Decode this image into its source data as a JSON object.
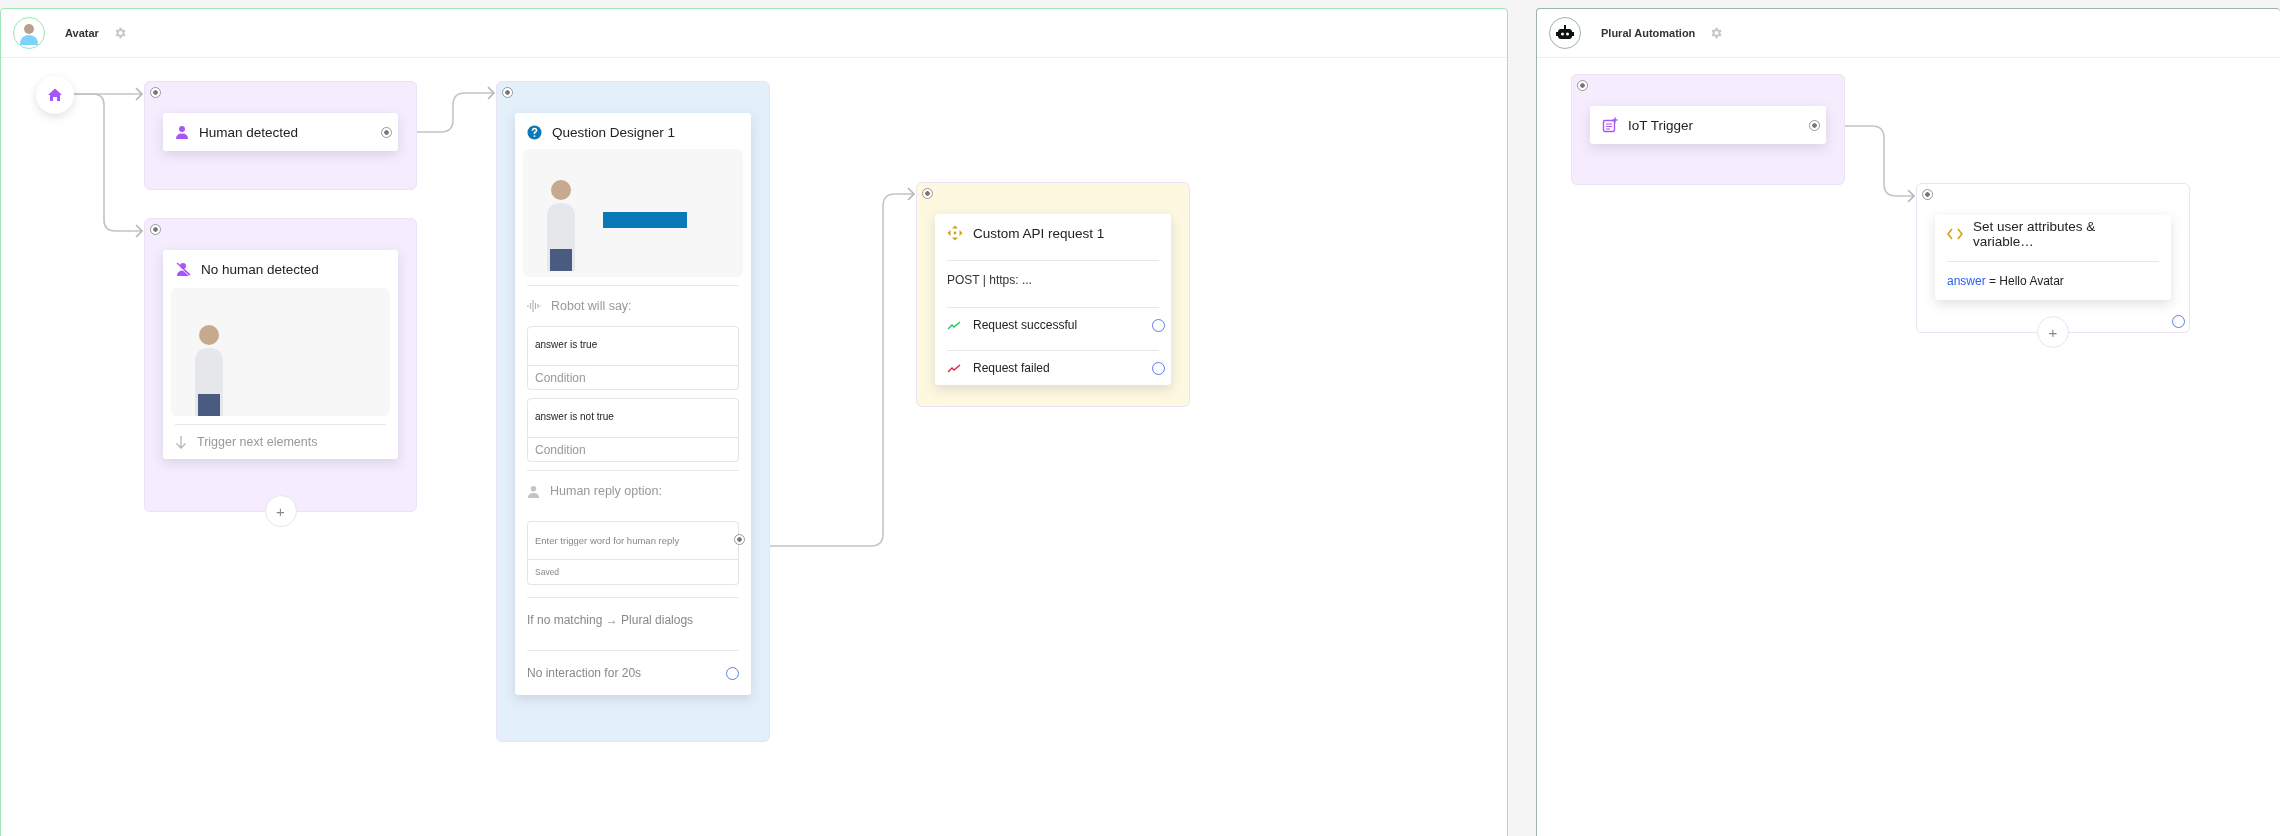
{
  "panels": [
    {
      "title": "Avatar",
      "start": {
        "kind": "home"
      },
      "groups": [
        {
          "color": "#f5edfd",
          "card": {
            "kind": "trigger",
            "title": "Human detected"
          }
        },
        {
          "color": "#f5edfd",
          "add_label": "+",
          "card": {
            "kind": "trigger_preview",
            "title": "No human detected",
            "footer": "Trigger next elements"
          }
        },
        {
          "color": "#e3f0fa",
          "card": {
            "kind": "question",
            "title": "Question Designer 1",
            "say_label": "Robot will say:",
            "conditions": [
              {
                "text": "answer is true",
                "placeholder": "Condition"
              },
              {
                "text": "answer is not true",
                "placeholder": "Condition"
              }
            ],
            "reply_label": "Human reply option:",
            "reply": {
              "placeholder": "Enter trigger word for human reply",
              "status": "Saved"
            },
            "fallback": "If no matching → Plural dialogs",
            "timeout": "No interaction for 20s"
          }
        },
        {
          "color": "#fdf8df",
          "card": {
            "kind": "api",
            "title": "Custom API request 1",
            "request": "POST | https: ...",
            "outcomes": [
              {
                "label": "Request successful",
                "color": "#22c55e"
              },
              {
                "label": "Request failed",
                "color": "#e11d48"
              }
            ]
          }
        }
      ]
    },
    {
      "title": "Plural Automation",
      "groups": [
        {
          "color": "#f5edfd",
          "card": {
            "kind": "trigger",
            "title": "IoT Trigger"
          }
        },
        {
          "color": "#ffffff",
          "add_label": "+",
          "card": {
            "kind": "variables",
            "title": "Set user attributes & variable…",
            "assignment": {
              "name": "answer",
              "expression": "= Hello Avatar"
            }
          }
        }
      ]
    }
  ]
}
